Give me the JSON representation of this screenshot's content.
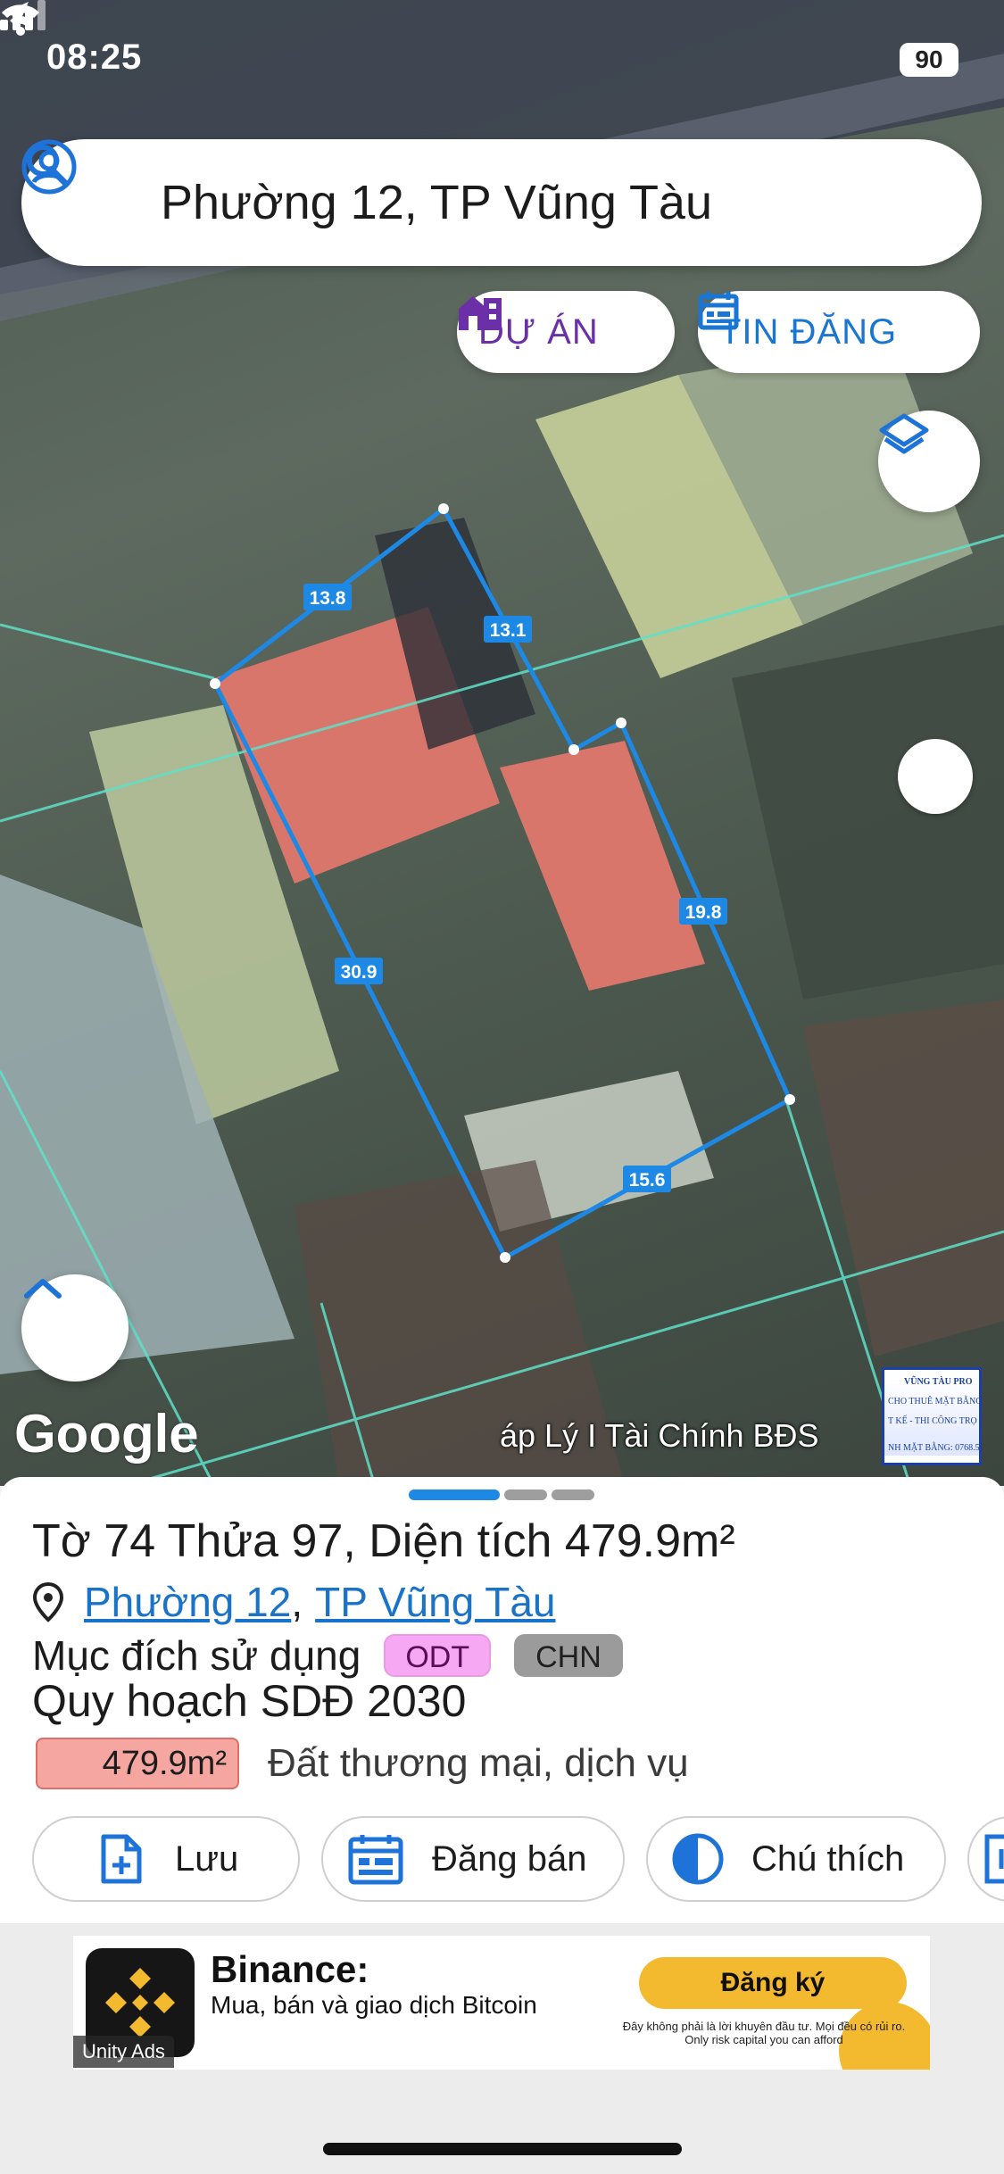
{
  "status_bar": {
    "time": "08:25",
    "battery": "90"
  },
  "search": {
    "text": "Phường 12, TP Vũng Tàu"
  },
  "chips": {
    "projects": "DỰ ÁN",
    "listings": "TIN ĐĂNG"
  },
  "map": {
    "edge_labels": [
      "13.8",
      "13.1",
      "19.8",
      "30.9",
      "15.6"
    ],
    "google_logo": "Google",
    "credit": "áp Lý I Tài Chính BĐS",
    "ad_thumb_lines": [
      "VŨNG TÀU PRO",
      "CHO THUÊ MẶT BẰNG",
      "T KẾ - THI CÔNG TRỌ",
      "NH MẶT BẰNG: 0768.5"
    ],
    "colors": {
      "parcel_outline": "#1e88e5",
      "cadastral_lines": "#5fe0c8"
    }
  },
  "sheet": {
    "title": "Tờ 74 Thửa 97, Diện tích 479.9m²",
    "location": {
      "ward": "Phường 12",
      "separator": ",",
      "city": "TP Vũng Tàu"
    },
    "purpose_label": "Mục đích sử dụng",
    "tags": [
      "ODT",
      "CHN"
    ],
    "plan_title": "Quy hoạch SDĐ 2030",
    "plan_area": "479.9m²",
    "plan_desc": "Đất thương mại, dịch vụ",
    "actions": {
      "save": "Lưu",
      "sell": "Đăng bán",
      "legend": "Chú thích"
    }
  },
  "ad": {
    "title": "Binance:",
    "subtitle": "Mua, bán và giao dịch Bitcoin",
    "cta": "Đăng ký",
    "disclaimer": "Đây không phải là lời khuyên đầu tư. Mọi đều có rủi ro. Only risk capital you can afford",
    "badge": "Unity Ads"
  }
}
